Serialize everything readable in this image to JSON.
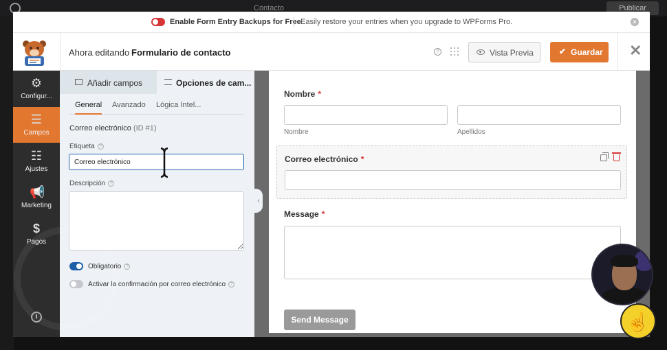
{
  "background_bar": {
    "contacto": "Contacto",
    "publicar": "Publicar"
  },
  "notice": {
    "title": "Enable Form Entry Backups for Free",
    "description": "Easily restore your entries when you upgrade to WPForms Pro."
  },
  "header": {
    "editing_prefix": "Ahora editando",
    "form_name": "Formulario de contacto",
    "preview_label": "Vista Previa",
    "save_label": "Guardar"
  },
  "sidenav": {
    "items": [
      {
        "label": "Configur...",
        "icon": "gear-icon",
        "active": false
      },
      {
        "label": "Campos",
        "icon": "fields-list-icon",
        "active": true
      },
      {
        "label": "Ajustes",
        "icon": "sliders-icon",
        "active": false
      },
      {
        "label": "Marketing",
        "icon": "megaphone-icon",
        "active": false
      },
      {
        "label": "Pagos",
        "icon": "dollar-icon",
        "active": false
      }
    ]
  },
  "panel": {
    "tabs": [
      "Añadir campos",
      "Opciones de cam..."
    ],
    "subtabs": [
      "General",
      "Avanzado",
      "Lógica Intel..."
    ],
    "field_title": "Correo electrónico",
    "field_id": "(ID #1)",
    "label_caption": "Etiqueta",
    "label_value": "Correo electrónico",
    "description_caption": "Descripción",
    "required_label": "Obligatorio",
    "required_on": true,
    "confirmation_label": "Activar la confirmación por correo electrónico",
    "confirmation_on": false
  },
  "preview": {
    "name_label": "Nombre",
    "first_sub": "Nombre",
    "last_sub": "Apellidos",
    "email_label": "Correo electrónico",
    "message_label": "Message",
    "required_mark": "*",
    "send_label": "Send Message"
  },
  "colors": {
    "accent_orange": "#e27730",
    "primary_blue": "#1e5fa8",
    "required_red": "#d63638",
    "nav_dark": "#2d2d2d"
  }
}
